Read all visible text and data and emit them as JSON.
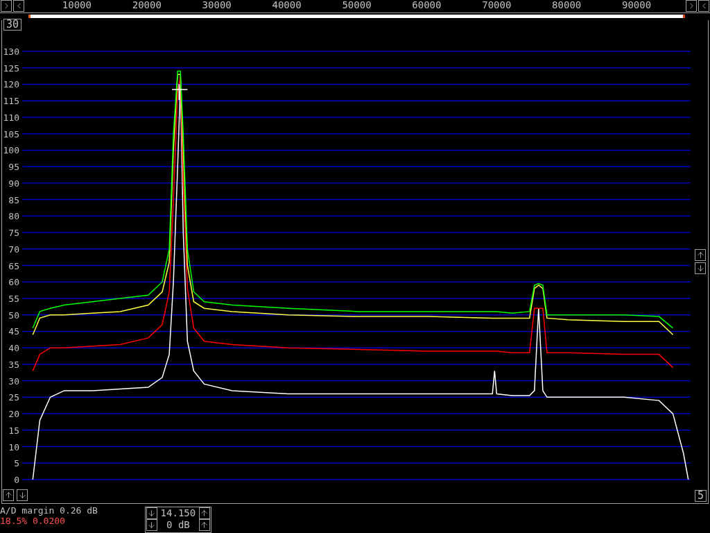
{
  "spectrum": {
    "avg_count": "30",
    "scale_box": "5",
    "chart_data": {
      "type": "line",
      "x": [
        3500,
        4500,
        6000,
        8000,
        12000,
        16000,
        20000,
        22000,
        23000,
        23600,
        24200,
        24600,
        25000,
        25600,
        26500,
        28000,
        32000,
        40000,
        50000,
        60000,
        69200,
        69500,
        69800,
        72000,
        74500,
        75200,
        75800,
        76400,
        77000,
        80000,
        88000,
        93000,
        95000,
        96500,
        97200
      ],
      "series": [
        {
          "color": "#ffffff",
          "values": [
            0,
            18,
            25,
            27,
            27,
            27.5,
            28,
            31,
            38,
            60,
            95,
            120,
            75,
            42,
            33,
            29,
            27,
            26,
            26,
            26,
            26,
            33,
            26,
            25.5,
            25.5,
            27,
            52,
            27,
            25,
            25,
            25,
            24,
            20,
            8,
            0
          ]
        },
        {
          "color": "#ff0000",
          "values": [
            33,
            38,
            40,
            40,
            40.5,
            41,
            43,
            47,
            57,
            85,
            118,
            122,
            90,
            58,
            46,
            42,
            41,
            40,
            39.5,
            39,
            39,
            39,
            39,
            38.5,
            38.5,
            52,
            52,
            52,
            38.5,
            38.5,
            38,
            38,
            34,
            null,
            null
          ]
        },
        {
          "color": "#ffff40",
          "values": [
            44,
            49,
            50,
            50,
            50.5,
            51,
            53,
            57,
            66,
            100,
            123,
            123,
            100,
            65,
            54,
            52,
            51,
            50,
            49.5,
            49.5,
            49,
            49,
            49,
            49,
            49,
            58,
            59,
            58,
            49,
            48.5,
            48,
            48,
            44,
            null,
            null
          ]
        },
        {
          "color": "#00ff00",
          "values": [
            46,
            51,
            52,
            53,
            54,
            55,
            56,
            60,
            70,
            105,
            124,
            124,
            105,
            70,
            57,
            54,
            53,
            52,
            51,
            51,
            51,
            51,
            51,
            50.5,
            51,
            59,
            59.5,
            59,
            50,
            50,
            50,
            49.5,
            46,
            null,
            null
          ]
        }
      ],
      "xticks": [
        {
          "value": 10000,
          "label": "10000"
        },
        {
          "value": 20000,
          "label": "20000"
        },
        {
          "value": 30000,
          "label": "30000"
        },
        {
          "value": 40000,
          "label": "40000"
        },
        {
          "value": 50000,
          "label": "50000"
        },
        {
          "value": 60000,
          "label": "60000"
        },
        {
          "value": 70000,
          "label": "70000"
        },
        {
          "value": 80000,
          "label": "80000"
        },
        {
          "value": 90000,
          "label": "90000"
        }
      ],
      "yticks": [
        {
          "value": 0,
          "label": "0"
        },
        {
          "value": 5,
          "label": "5"
        },
        {
          "value": 10,
          "label": "10"
        },
        {
          "value": 15,
          "label": "15"
        },
        {
          "value": 20,
          "label": "20"
        },
        {
          "value": 25,
          "label": "25"
        },
        {
          "value": 30,
          "label": "30"
        },
        {
          "value": 35,
          "label": "35"
        },
        {
          "value": 40,
          "label": "40"
        },
        {
          "value": 45,
          "label": "45"
        },
        {
          "value": 50,
          "label": "50"
        },
        {
          "value": 55,
          "label": "55"
        },
        {
          "value": 60,
          "label": "60"
        },
        {
          "value": 65,
          "label": "65"
        },
        {
          "value": 70,
          "label": "70"
        },
        {
          "value": 75,
          "label": "75"
        },
        {
          "value": 80,
          "label": "80"
        },
        {
          "value": 85,
          "label": "85"
        },
        {
          "value": 90,
          "label": "90"
        },
        {
          "value": 95,
          "label": "95"
        },
        {
          "value": 100,
          "label": "100"
        },
        {
          "value": 105,
          "label": "105"
        },
        {
          "value": 110,
          "label": "110"
        },
        {
          "value": 115,
          "label": "115"
        },
        {
          "value": 120,
          "label": "120"
        },
        {
          "value": 125,
          "label": "125"
        },
        {
          "value": 130,
          "label": "130"
        }
      ],
      "ylim": [
        0,
        130
      ],
      "xlim": [
        2000,
        97500
      ],
      "grid": true
    }
  },
  "status": {
    "ad_margin": "A/D margin 0.26 dB",
    "overload": "18.5% 0.0200"
  },
  "gain_control": {
    "rows": [
      {
        "value": "14.150"
      },
      {
        "value": "0 dB"
      }
    ]
  }
}
